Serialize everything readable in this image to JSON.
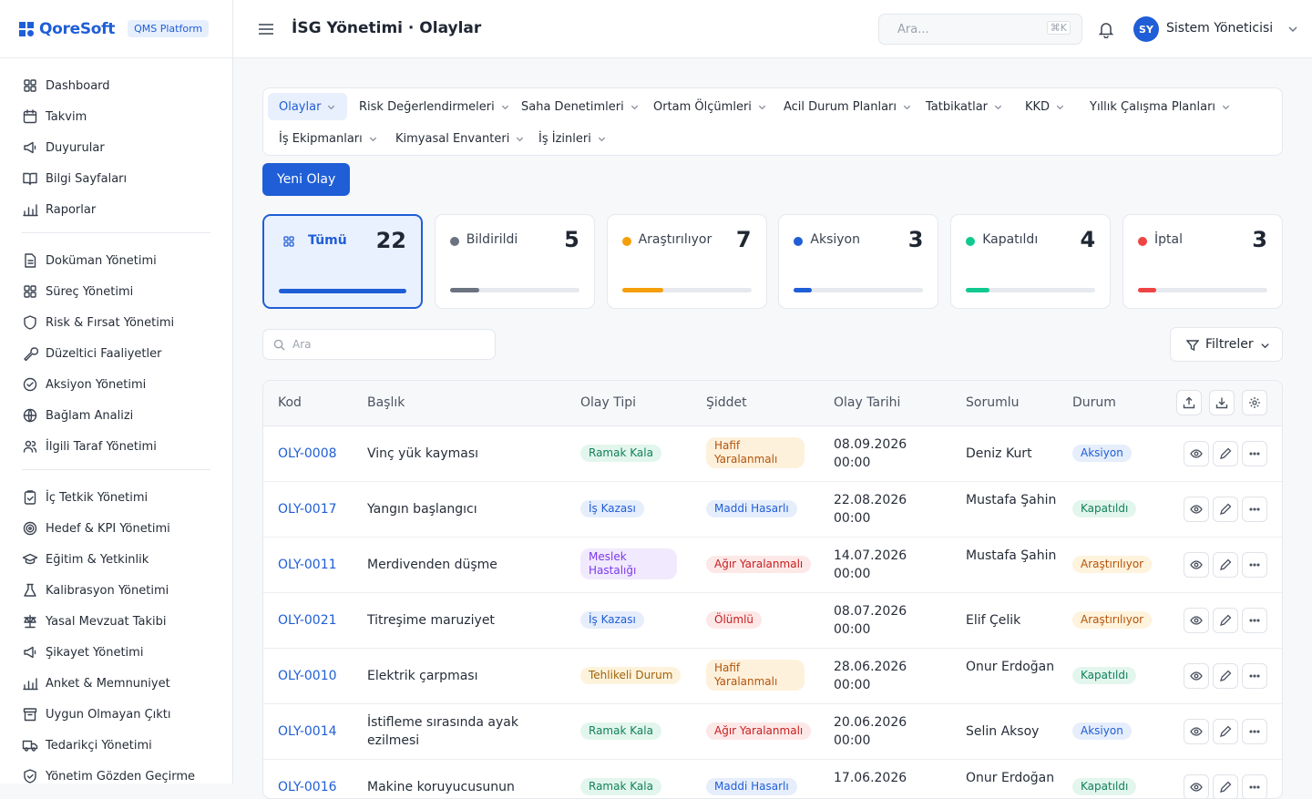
{
  "brand": {
    "name": "QoreSoft",
    "badge": "QMS Platform"
  },
  "sidebar": {
    "groups": [
      [
        {
          "label": "Dashboard",
          "icon": "grid-icon"
        },
        {
          "label": "Takvim",
          "icon": "calendar-icon"
        },
        {
          "label": "Duyurular",
          "icon": "megaphone-icon"
        },
        {
          "label": "Bilgi Sayfaları",
          "icon": "book-icon"
        },
        {
          "label": "Raporlar",
          "icon": "bar-chart-icon"
        }
      ],
      [
        {
          "label": "Doküman Yönetimi",
          "icon": "document-icon"
        },
        {
          "label": "Süreç Yönetimi",
          "icon": "grid-icon"
        },
        {
          "label": "Risk & Fırsat Yönetimi",
          "icon": "shield-icon"
        },
        {
          "label": "Düzeltici Faaliyetler",
          "icon": "wrench-icon"
        },
        {
          "label": "Aksiyon Yönetimi",
          "icon": "check-circle-icon"
        },
        {
          "label": "Bağlam Analizi",
          "icon": "globe-icon"
        },
        {
          "label": "İlgili Taraf Yönetimi",
          "icon": "users-icon"
        }
      ],
      [
        {
          "label": "İç Tetkik Yönetimi",
          "icon": "clipboard-icon"
        },
        {
          "label": "Hedef & KPI Yönetimi",
          "icon": "target-icon"
        },
        {
          "label": "Eğitim & Yetkinlik",
          "icon": "graduation-cap-icon"
        },
        {
          "label": "Kalibrasyon Yönetimi",
          "icon": "flask-icon"
        },
        {
          "label": "Yasal Mevzuat Takibi",
          "icon": "scale-icon"
        },
        {
          "label": "Şikayet Yönetimi",
          "icon": "megaphone-icon"
        },
        {
          "label": "Anket & Memnuniyet",
          "icon": "bar-chart-icon"
        },
        {
          "label": "Uygun Olmayan Çıktı",
          "icon": "archive-icon"
        },
        {
          "label": "Tedarikçi Yönetimi",
          "icon": "truck-icon"
        },
        {
          "label": "Yönetim Gözden Geçirme",
          "icon": "shield-check-icon"
        }
      ]
    ]
  },
  "header": {
    "title": "İSG Yönetimi · Olaylar",
    "search_placeholder": "Ara...",
    "search_shortcut": "⌘K",
    "user_initials": "SY",
    "user_name": "Sistem Yöneticisi"
  },
  "module_tabs": [
    "Olaylar",
    "Risk Değerlendirmeleri",
    "Saha Denetimleri",
    "Ortam Ölçümleri",
    "Acil Durum Planları",
    "Tatbikatlar",
    "KKD",
    "Yıllık Çalışma Planları",
    "İş Ekipmanları",
    "Kimyasal Envanteri",
    "İş İzinleri"
  ],
  "active_tab": "Olaylar",
  "new_button": "Yeni Olay",
  "stats": [
    {
      "label": "Tümü",
      "count": 22,
      "color": "#1f5ed6",
      "fill": 1.0
    },
    {
      "label": "Bildirildi",
      "count": 5,
      "color": "#6b7280",
      "fill": 0.23
    },
    {
      "label": "Araştırılıyor",
      "count": 7,
      "color": "#f59e0b",
      "fill": 0.32
    },
    {
      "label": "Aksiyon",
      "count": 3,
      "color": "#1f5ed6",
      "fill": 0.14
    },
    {
      "label": "Kapatıldı",
      "count": 4,
      "color": "#10c98f",
      "fill": 0.18
    },
    {
      "label": "İptal",
      "count": 3,
      "color": "#ef4444",
      "fill": 0.14
    }
  ],
  "list_search_placeholder": "Ara",
  "filters_label": "Filtreler",
  "table": {
    "columns": [
      "Kod",
      "Başlık",
      "Olay Tipi",
      "Şiddet",
      "Olay Tarihi",
      "Sorumlu",
      "Durum"
    ],
    "rows": [
      {
        "kod": "OLY-0008",
        "baslik": "Vinç yük kayması",
        "tip": "Ramak Kala",
        "siddet": "Hafif Yaralanmalı",
        "tarih": "08.09.2026 00:00",
        "sorumlu": "Deniz Kurt",
        "durum": "Aksiyon"
      },
      {
        "kod": "OLY-0017",
        "baslik": "Yangın başlangıcı",
        "tip": "İş Kazası",
        "siddet": "Maddi Hasarlı",
        "tarih": "22.08.2026 00:00",
        "sorumlu": "Mustafa Şahin",
        "durum": "Kapatıldı"
      },
      {
        "kod": "OLY-0011",
        "baslik": "Merdivenden düşme",
        "tip": "Meslek Hastalığı",
        "siddet": "Ağır Yaralanmalı",
        "tarih": "14.07.2026 00:00",
        "sorumlu": "Mustafa Şahin",
        "durum": "Araştırılıyor"
      },
      {
        "kod": "OLY-0021",
        "baslik": "Titreşime maruziyet",
        "tip": "İş Kazası",
        "siddet": "Ölümlü",
        "tarih": "08.07.2026 00:00",
        "sorumlu": "Elif Çelik",
        "durum": "Araştırılıyor"
      },
      {
        "kod": "OLY-0010",
        "baslik": "Elektrik çarpması",
        "tip": "Tehlikeli Durum",
        "siddet": "Hafif Yaralanmalı",
        "tarih": "28.06.2026 00:00",
        "sorumlu": "Onur Erdoğan",
        "durum": "Kapatıldı"
      },
      {
        "kod": "OLY-0014",
        "baslik": "İstifleme sırasında ayak ezilmesi",
        "tip": "Ramak Kala",
        "siddet": "Ağır Yaralanmalı",
        "tarih": "20.06.2026 00:00",
        "sorumlu": "Selin Aksoy",
        "durum": "Aksiyon"
      },
      {
        "kod": "OLY-0016",
        "baslik": "Makine koruyucusunun",
        "tip": "Ramak Kala",
        "siddet": "Maddi Hasarlı",
        "tarih": "17.06.2026",
        "sorumlu": "Onur Erdoğan",
        "durum": "Kapatıldı"
      }
    ]
  },
  "pill_colors": {
    "Ramak Kala": [
      "#e3f6ee",
      "#12805c"
    ],
    "İş Kazası": [
      "#e6eefc",
      "#1f5ed6"
    ],
    "Meslek Hastalığı": [
      "#f1e9fd",
      "#7c3aed"
    ],
    "Tehlikeli Durum": [
      "#fdf3dc",
      "#a16207"
    ],
    "Hafif Yaralanmalı": [
      "#fef1dc",
      "#b45309"
    ],
    "Maddi Hasarlı": [
      "#e6eefc",
      "#1f5ed6"
    ],
    "Ağır Yaralanmalı": [
      "#fde8e8",
      "#c81e1e"
    ],
    "Ölümlü": [
      "#fde8e8",
      "#c81e1e"
    ],
    "Aksiyon": [
      "#e6eefc",
      "#1f5ed6"
    ],
    "Kapatıldı": [
      "#e3f6ee",
      "#12805c"
    ],
    "Araştırılıyor": [
      "#fef3dc",
      "#b45309"
    ]
  }
}
